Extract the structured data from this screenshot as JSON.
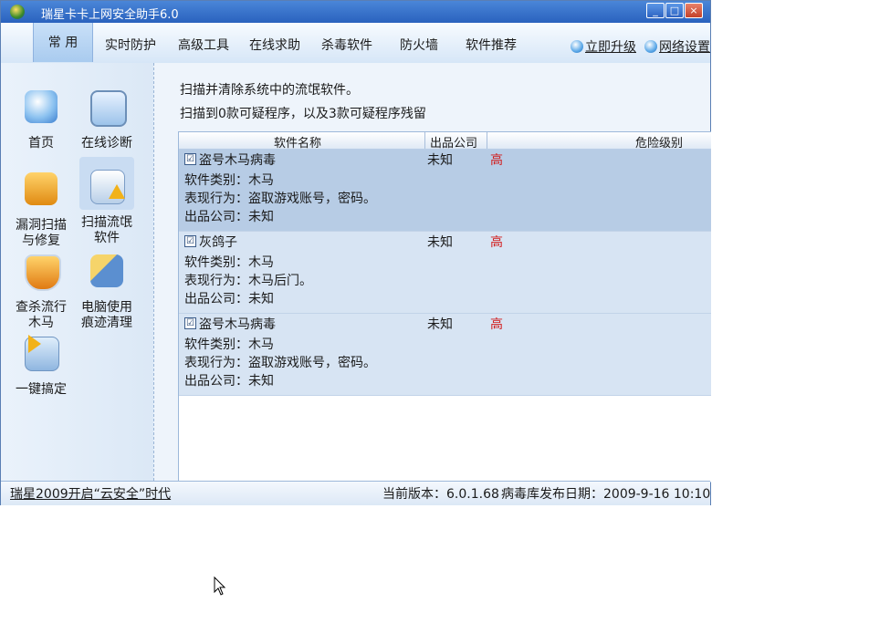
{
  "window": {
    "title": "瑞星卡卡上网安全助手6.0",
    "controls": [
      "_",
      "□",
      "×"
    ]
  },
  "menu": {
    "items": [
      "常 用",
      "实时防护",
      "高级工具",
      "在线求助",
      "杀毒软件",
      "防火墙",
      "软件推荐"
    ],
    "right": [
      "立即升级",
      "网络设置"
    ]
  },
  "sidebar": {
    "tools": [
      {
        "label": "首页",
        "icon": "home-icon"
      },
      {
        "label": "在线诊断",
        "icon": "stethoscope-icon"
      },
      {
        "label": "漏洞扫描与修复",
        "icon": "shield-box-icon"
      },
      {
        "label": "扫描流氓软件",
        "icon": "warning-window-icon"
      },
      {
        "label": "查杀流行木马",
        "icon": "shield-icon"
      },
      {
        "label": "电脑使用痕迹清理",
        "icon": "broom-icon"
      },
      {
        "label": "一键搞定",
        "icon": "one-click-icon"
      }
    ]
  },
  "content": {
    "line1": "扫描并清除系统中的流氓软件。",
    "line2": "扫描到0款可疑程序，以及3款可疑程序残留",
    "columns": [
      "软件名称",
      "出品公司",
      "危险级别"
    ],
    "rows": [
      {
        "name": "盗号木马病毒",
        "company": "未知",
        "level": "高",
        "type": "软件类别：木马",
        "behavior": "表现行为：盗取游戏账号，密码。",
        "publisher": "出品公司：未知",
        "checked": "☑"
      },
      {
        "name": "灰鸽子",
        "company": "未知",
        "level": "高",
        "type": "软件类别：木马",
        "behavior": "表现行为：木马后门。",
        "publisher": "出品公司：未知",
        "checked": "☑"
      },
      {
        "name": "盗号木马病毒",
        "company": "未知",
        "level": "高",
        "type": "软件类别：木马",
        "behavior": "表现行为：盗取游戏账号，密码。",
        "publisher": "出品公司：未知",
        "checked": "☑"
      }
    ]
  },
  "status": {
    "left": "瑞星2009开启“云安全”时代",
    "version": "当前版本：6.0.1.68",
    "release": "病毒库发布日期：2009-9-16 10:10"
  }
}
